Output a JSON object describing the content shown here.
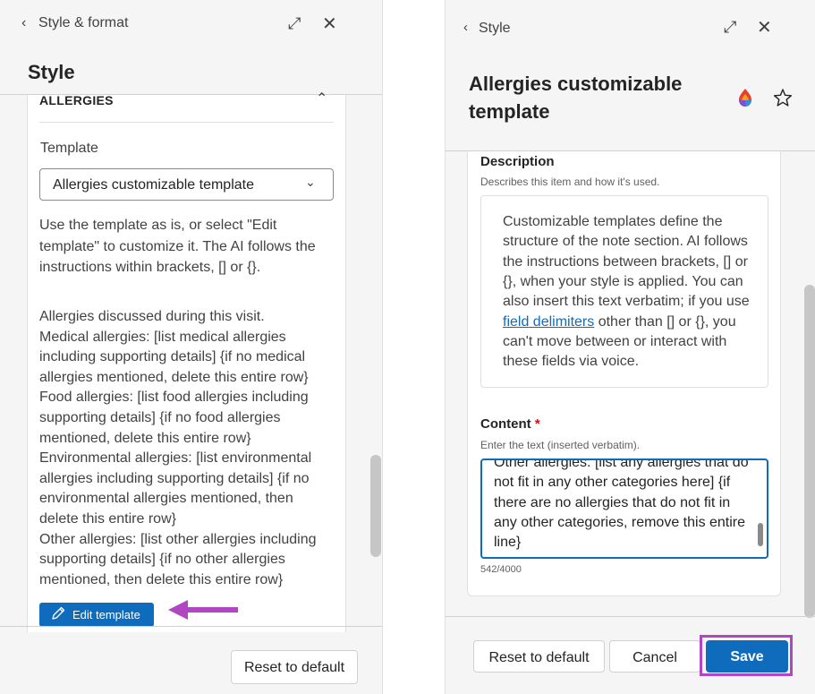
{
  "colors": {
    "accent": "#0f6cbd",
    "highlight_arrow": "#b146c2",
    "required": "#c50f1f",
    "panel_bg": "#f5f5f5"
  },
  "left_panel": {
    "header": {
      "back_icon": "chevron-left-icon",
      "back_glyph": "‹",
      "title": "Style & format",
      "expand_icon": "expand-icon",
      "expand_glyph": "⤢",
      "close_icon": "close-icon",
      "close_glyph": "✕"
    },
    "title": "Style",
    "section": {
      "heading": "ALLERGIES",
      "collapse_glyph": "⌃",
      "template_label": "Template",
      "select_value": "Allergies customizable template",
      "select_glyph": "⌄",
      "help_text": "Use the template as is, or select \"Edit template\" to customize it. The AI follows the instructions within brackets, [] or {}.",
      "template_lines": [
        "Allergies discussed during this visit.",
        "Medical allergies: [list medical allergies",
        "including supporting details] {if no medical",
        "allergies mentioned, delete this entire row}",
        "Food allergies: [list food allergies including",
        "supporting details] {if no food allergies",
        "mentioned, delete this entire row}",
        "Environmental allergies: [list environmental",
        "allergies including supporting details] {if no",
        "environmental allergies mentioned, then",
        "delete this entire row}",
        "Other allergies: [list other allergies including",
        "supporting details] {if no other allergies",
        "mentioned, then delete this entire row}"
      ],
      "edit_button": "Edit template"
    },
    "footer": {
      "reset_button": "Reset to default"
    }
  },
  "right_panel": {
    "header": {
      "back_glyph": "‹",
      "title": "Style",
      "expand_glyph": "⤢",
      "close_glyph": "✕"
    },
    "title": "Allergies customizable template",
    "description": {
      "label": "Description",
      "sub": "Describes this item and how it's used.",
      "lines": [
        {
          "text": "Customizable templates define the"
        },
        {
          "text": "structure of the note section. AI follows"
        },
        {
          "text": "the instructions between brackets, [] or"
        },
        {
          "text": "{}, when your style is applied. You can"
        },
        {
          "text": "also insert this text verbatim; if you use"
        },
        {
          "link": "field delimiters",
          "text": " other than [] or {}, you"
        },
        {
          "text": "can't move between or interact with"
        },
        {
          "text": "these fields via voice."
        }
      ]
    },
    "content": {
      "label": "Content",
      "required_marker": "*",
      "sub": "Enter the text (inserted verbatim).",
      "lines": [
        "Other allergies: [list any allergies that do",
        "not fit in any other categories here] {if",
        "there are no allergies that do not fit in",
        "any other categories, remove this entire",
        "line}"
      ],
      "counter": "542/4000"
    },
    "footer": {
      "reset_button": "Reset to default",
      "cancel_button": "Cancel",
      "save_button": "Save"
    }
  }
}
